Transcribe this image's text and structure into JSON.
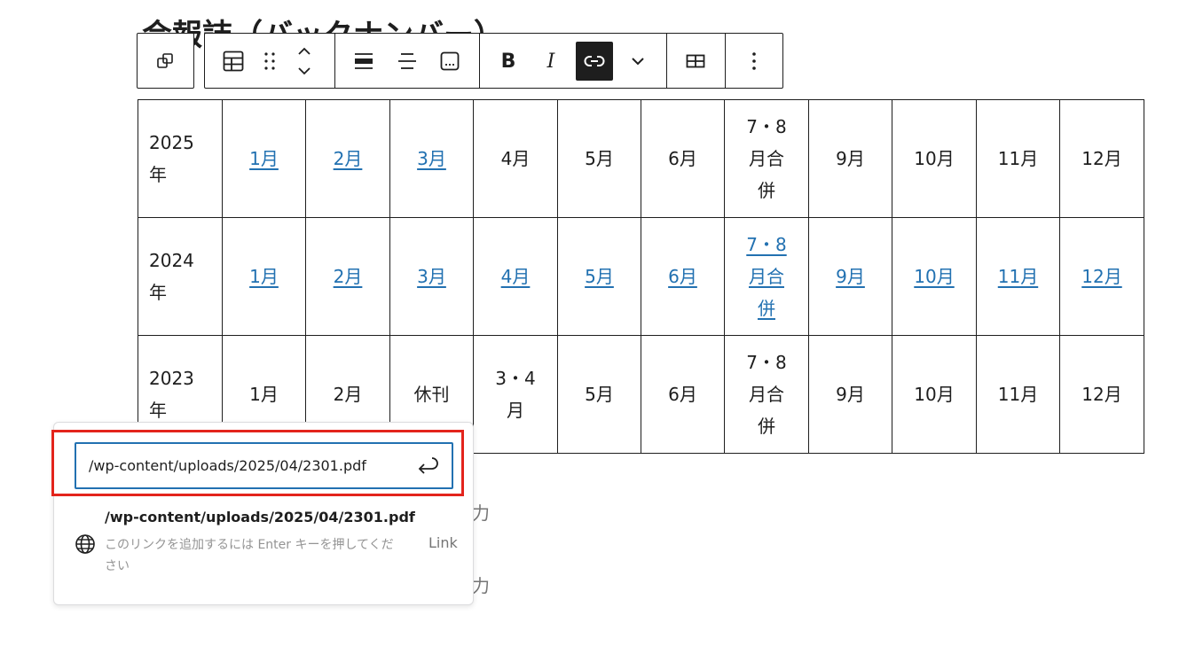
{
  "heading": "会報誌（バックナンバー）",
  "toolbar": {
    "icons": [
      "transform-icon",
      "table-icon",
      "drag-handle-icon",
      "move-up-down-icon",
      "align-full-icon",
      "align-center-icon",
      "caption-icon",
      "bold-icon",
      "italic-icon",
      "link-icon",
      "chevron-down-icon",
      "table-edit-icon",
      "more-options-icon"
    ],
    "bold_label": "B",
    "italic_label": "I"
  },
  "table": {
    "rows": [
      {
        "year": [
          "2025",
          "年"
        ],
        "cells": [
          {
            "text": "1月",
            "link": true
          },
          {
            "text": "2月",
            "link": true
          },
          {
            "text": "3月",
            "link": true
          },
          {
            "text": "4月",
            "link": false
          },
          {
            "text": "5月",
            "link": false
          },
          {
            "text": "6月",
            "link": false
          },
          {
            "text": [
              "7・8",
              "月合",
              "併"
            ],
            "link": false
          },
          {
            "text": "9月",
            "link": false
          },
          {
            "text": "10月",
            "link": false
          },
          {
            "text": "11月",
            "link": false
          },
          {
            "text": "12月",
            "link": false
          }
        ]
      },
      {
        "year": [
          "2024",
          "年"
        ],
        "cells": [
          {
            "text": "1月",
            "link": true
          },
          {
            "text": "2月",
            "link": true
          },
          {
            "text": "3月",
            "link": true
          },
          {
            "text": "4月",
            "link": true
          },
          {
            "text": "5月",
            "link": true
          },
          {
            "text": "6月",
            "link": true
          },
          {
            "text": [
              "7・8",
              "月合",
              "併"
            ],
            "link": true
          },
          {
            "text": "9月",
            "link": true
          },
          {
            "text": "10月",
            "link": true
          },
          {
            "text": "11月",
            "link": true
          },
          {
            "text": "12月",
            "link": true
          }
        ]
      },
      {
        "year": [
          "2023",
          "年"
        ],
        "cells": [
          {
            "text": "1月",
            "link": false
          },
          {
            "text": "2月",
            "link": false
          },
          {
            "text": "休刊",
            "link": false
          },
          {
            "text": [
              "3・4",
              "月"
            ],
            "link": false
          },
          {
            "text": "5月",
            "link": false
          },
          {
            "text": "6月",
            "link": false
          },
          {
            "text": [
              "7・8",
              "月合",
              "併"
            ],
            "link": false
          },
          {
            "text": "9月",
            "link": false
          },
          {
            "text": "10月",
            "link": false
          },
          {
            "text": "11月",
            "link": false
          },
          {
            "text": "12月",
            "link": false
          }
        ]
      }
    ]
  },
  "background_text": [
    "力",
    "力"
  ],
  "link_popover": {
    "url_value": "/wp-content/uploads/2025/04/2301.pdf",
    "submit_icon": "enter-icon",
    "suggestion": {
      "icon": "globe-icon",
      "title": "/wp-content/uploads/2025/04/2301.pdf",
      "info": "このリンクを追加するには Enter キーを押してください",
      "type": "Link"
    }
  },
  "colors": {
    "link": "#2271b1",
    "input_border": "#2271b1",
    "highlight": "#e3241c",
    "active_button": "#1e1e1e"
  }
}
